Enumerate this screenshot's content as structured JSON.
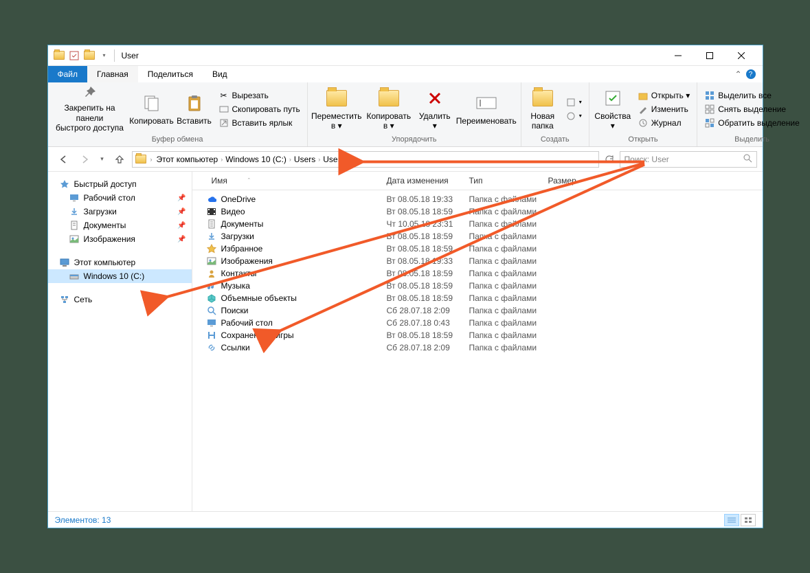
{
  "title": "User",
  "ribbon_tabs": {
    "file": "Файл",
    "home": "Главная",
    "share": "Поделиться",
    "view": "Вид"
  },
  "ribbon": {
    "clipboard": {
      "pin": "Закрепить на панели\nбыстрого доступа",
      "copy": "Копировать",
      "paste": "Вставить",
      "cut": "Вырезать",
      "copy_path": "Скопировать путь",
      "paste_shortcut": "Вставить ярлык",
      "label": "Буфер обмена"
    },
    "organize": {
      "move": "Переместить\nв ▾",
      "copy_to": "Копировать\nв ▾",
      "delete": "Удалить\n▾",
      "rename": "Переименовать",
      "label": "Упорядочить"
    },
    "new": {
      "folder": "Новая\nпапка",
      "label": "Создать"
    },
    "open": {
      "properties": "Свойства\n▾",
      "open": "Открыть ▾",
      "edit": "Изменить",
      "history": "Журнал",
      "label": "Открыть"
    },
    "select": {
      "all": "Выделить все",
      "none": "Снять выделение",
      "invert": "Обратить выделение",
      "label": "Выделить"
    }
  },
  "breadcrumb": [
    "Этот компьютер",
    "Windows 10 (C:)",
    "Users",
    "User"
  ],
  "search_placeholder": "Поиск: User",
  "nav": {
    "quick_access": "Быстрый доступ",
    "qa_items": [
      {
        "label": "Рабочий стол",
        "pin": true
      },
      {
        "label": "Загрузки",
        "pin": true
      },
      {
        "label": "Документы",
        "pin": true
      },
      {
        "label": "Изображения",
        "pin": true
      }
    ],
    "this_pc": "Этот компьютер",
    "drive": "Windows 10 (C:)",
    "network": "Сеть"
  },
  "columns": {
    "name": "Имя",
    "date": "Дата изменения",
    "type": "Тип",
    "size": "Размер"
  },
  "files": [
    {
      "icon": "cloud",
      "name": "OneDrive",
      "date": "Вт 08.05.18 19:33",
      "type": "Папка с файлами"
    },
    {
      "icon": "video",
      "name": "Видео",
      "date": "Вт 08.05.18 18:59",
      "type": "Папка с файлами"
    },
    {
      "icon": "doc",
      "name": "Документы",
      "date": "Чт 10.05.18 23:31",
      "type": "Папка с файлами"
    },
    {
      "icon": "download",
      "name": "Загрузки",
      "date": "Вт 08.05.18 18:59",
      "type": "Папка с файлами"
    },
    {
      "icon": "star",
      "name": "Избранное",
      "date": "Вт 08.05.18 18:59",
      "type": "Папка с файлами"
    },
    {
      "icon": "image",
      "name": "Изображения",
      "date": "Вт 08.05.18 19:33",
      "type": "Папка с файлами"
    },
    {
      "icon": "contacts",
      "name": "Контакты",
      "date": "Вт 08.05.18 18:59",
      "type": "Папка с файлами"
    },
    {
      "icon": "music",
      "name": "Музыка",
      "date": "Вт 08.05.18 18:59",
      "type": "Папка с файлами"
    },
    {
      "icon": "cube",
      "name": "Объемные объекты",
      "date": "Вт 08.05.18 18:59",
      "type": "Папка с файлами"
    },
    {
      "icon": "search",
      "name": "Поиски",
      "date": "Сб 28.07.18 2:09",
      "type": "Папка с файлами"
    },
    {
      "icon": "desktop",
      "name": "Рабочий стол",
      "date": "Сб 28.07.18 0:43",
      "type": "Папка с файлами"
    },
    {
      "icon": "save",
      "name": "Сохраненные игры",
      "date": "Вт 08.05.18 18:59",
      "type": "Папка с файлами"
    },
    {
      "icon": "link",
      "name": "Ссылки",
      "date": "Сб 28.07.18 2:09",
      "type": "Папка с файлами"
    }
  ],
  "status": "Элементов: 13"
}
